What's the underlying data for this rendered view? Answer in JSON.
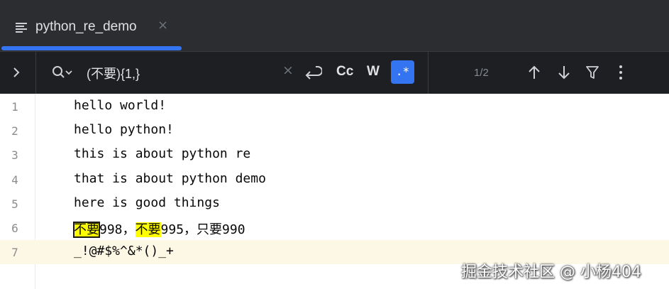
{
  "editor_tab": {
    "title": "python_re_demo",
    "close_glyph": "×",
    "icon": "text-file-icon"
  },
  "find_bar": {
    "query": "(不要){1,}",
    "clear_glyph": "×",
    "match_case_label": "Cc",
    "whole_words_label": "W",
    "regex_label": ".*",
    "result_counter": "1/2",
    "accent_color": "#3574f0"
  },
  "code_lines": [
    {
      "number": "1",
      "text": "hello world!"
    },
    {
      "number": "2",
      "text": "hello python!"
    },
    {
      "number": "3",
      "text": "this is about python re"
    },
    {
      "number": "4",
      "text": "that is about python demo"
    },
    {
      "number": "5",
      "text": "here is good things"
    },
    {
      "number": "6",
      "segments": [
        "不要",
        "998，",
        "不要",
        "995，只要990"
      ]
    },
    {
      "number": "7",
      "text": "_!@#$%^&*()_+"
    }
  ],
  "highlight_color": "#ffff00",
  "watermark": "掘金技术社区 @ 小杨404"
}
